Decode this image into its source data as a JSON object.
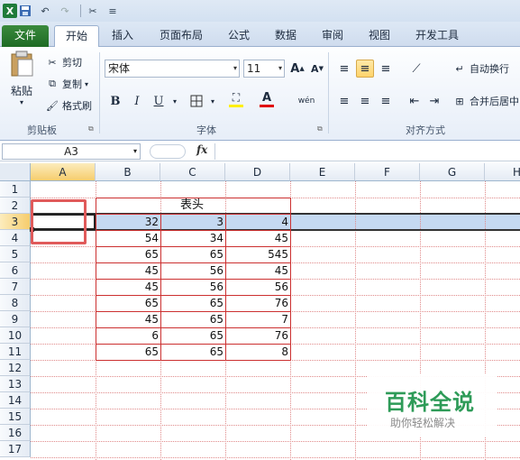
{
  "qat": {
    "logo": "X",
    "icons": [
      "save-icon",
      "undo-icon",
      "redo-icon",
      "customize-icon"
    ]
  },
  "tabs": [
    "文件",
    "开始",
    "插入",
    "页面布局",
    "公式",
    "数据",
    "审阅",
    "视图",
    "开发工具"
  ],
  "ribbon": {
    "clipboard": {
      "paste": "粘贴",
      "cut": "剪切",
      "copy": "复制",
      "format_painter": "格式刷",
      "title": "剪贴板"
    },
    "font": {
      "name": "宋体",
      "size": "11",
      "bold": "B",
      "italic": "I",
      "underline": "U",
      "title": "字体"
    },
    "alignment": {
      "wrap_text": "自动换行",
      "merge_center": "合并后居中",
      "title": "对齐方式"
    }
  },
  "formula_bar": {
    "name_box": "A3",
    "fx": "fx",
    "content": ""
  },
  "grid": {
    "columns": [
      "A",
      "B",
      "C",
      "D",
      "E",
      "F",
      "G",
      "H"
    ],
    "rows": [
      "1",
      "2",
      "3",
      "4",
      "5",
      "6",
      "7",
      "8",
      "9",
      "10",
      "11",
      "12",
      "13",
      "14",
      "15",
      "16",
      "17"
    ],
    "selected_cell": "A3",
    "header_cell": "表头",
    "table": [
      [
        "32",
        "3",
        "4"
      ],
      [
        "54",
        "34",
        "45"
      ],
      [
        "65",
        "65",
        "545"
      ],
      [
        "45",
        "56",
        "45"
      ],
      [
        "45",
        "56",
        "56"
      ],
      [
        "65",
        "65",
        "76"
      ],
      [
        "45",
        "65",
        "7"
      ],
      [
        "6",
        "65",
        "76"
      ],
      [
        "65",
        "65",
        "8"
      ]
    ]
  },
  "colors": {
    "accent_green": "#2e9b58",
    "highlight": "#c5d9f1",
    "border_red": "#cc3030"
  },
  "watermark": {
    "title": "百科全说",
    "subtitle": "助你轻松解决"
  }
}
